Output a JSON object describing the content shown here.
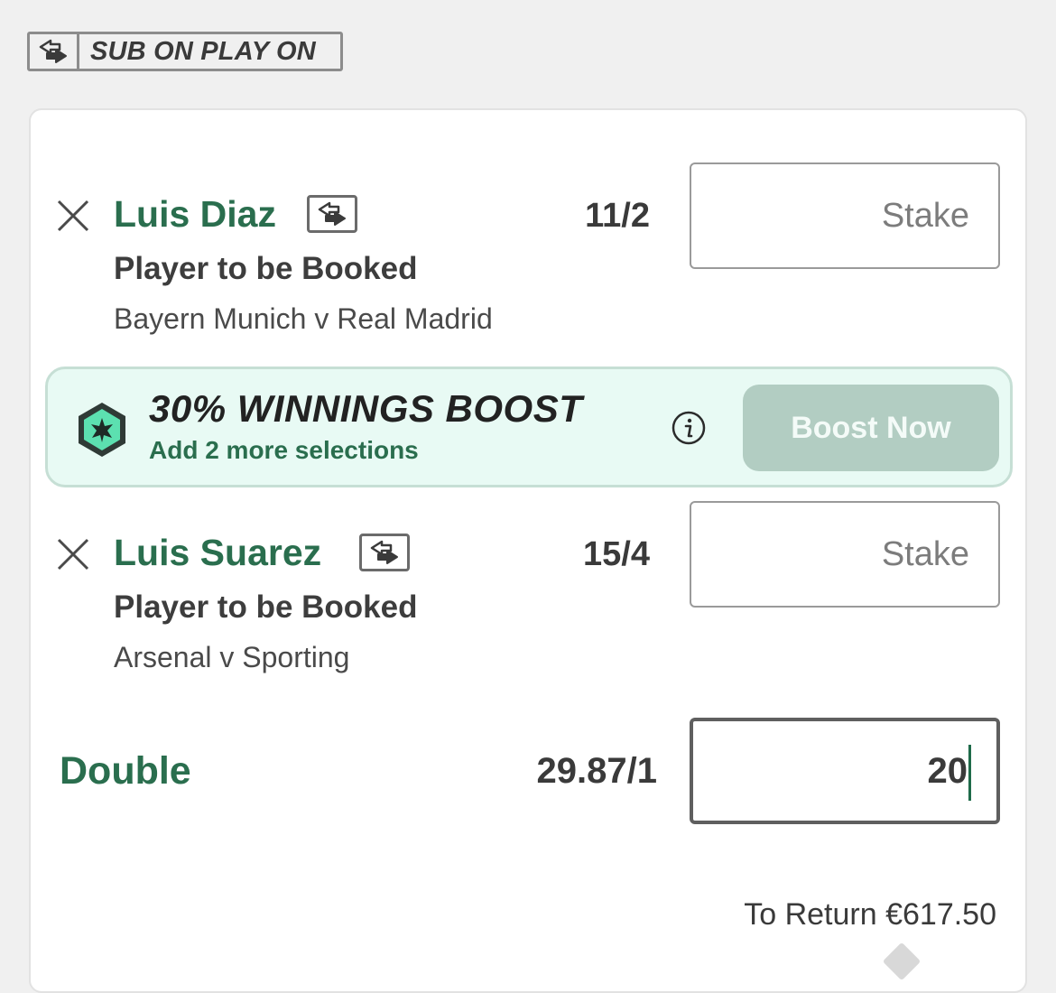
{
  "badge": {
    "label": "SUB ON PLAY ON",
    "icon": "sub-swap-icon"
  },
  "selections": [
    {
      "player": "Luis Diaz",
      "odds": "11/2",
      "market": "Player to be Booked",
      "event": "Bayern Munich v Real Madrid",
      "stake_placeholder": "Stake"
    },
    {
      "player": "Luis Suarez",
      "odds": "15/4",
      "market": "Player to be Booked",
      "event": "Arsenal v Sporting",
      "stake_placeholder": "Stake"
    }
  ],
  "boost": {
    "title": "30% WINNINGS BOOST",
    "subtitle": "Add 2 more selections",
    "button_label": "Boost Now",
    "icon": "star-hexagon-icon",
    "info_icon": "info-icon",
    "bg_color": "#e8faf4",
    "accent_color": "#2a6e4e"
  },
  "multiple": {
    "label": "Double",
    "odds": "29.87/1",
    "stake_value": "20"
  },
  "returns": {
    "text": "To Return €617.50"
  },
  "colors": {
    "brand_green": "#2a6e4e",
    "boost_button": "#b2cdc2"
  }
}
